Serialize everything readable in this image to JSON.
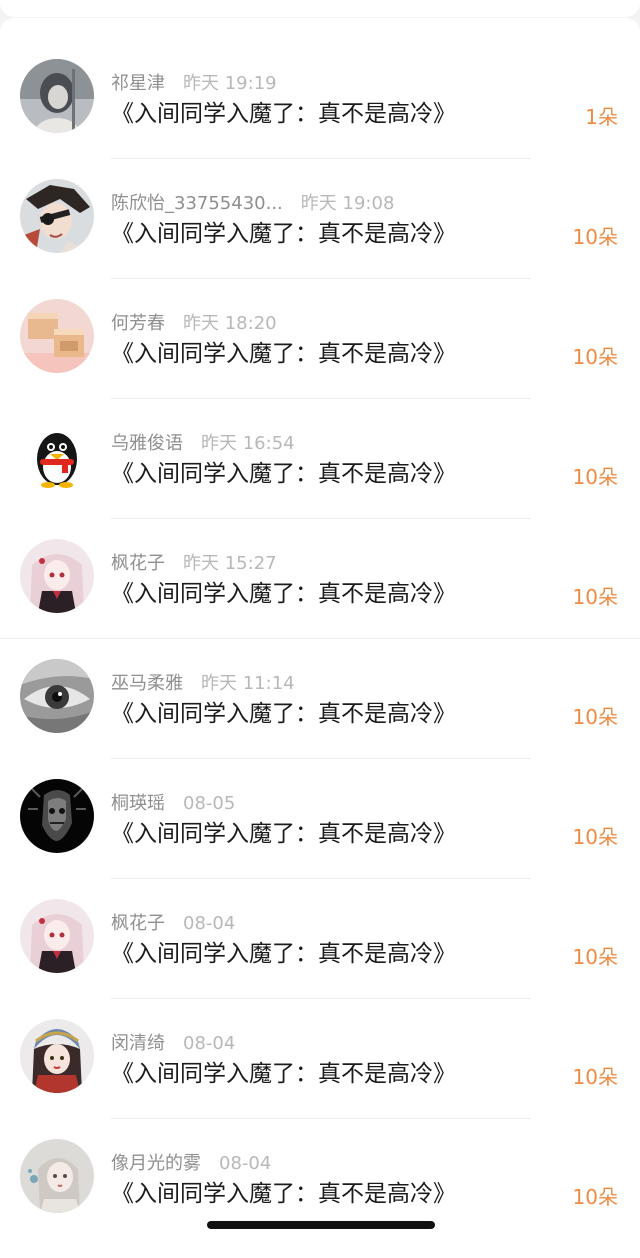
{
  "list": {
    "items": [
      {
        "name": "祁星津",
        "time": "昨天 19:19",
        "book": "《入间同学入魔了：真不是高冷》",
        "amount": "1朵",
        "avatar": "photo-girl-avatar"
      },
      {
        "name": "陈欣怡_33755430...",
        "time": "昨天 19:08",
        "book": "《入间同学入魔了：真不是高冷》",
        "amount": "10朵",
        "avatar": "anime-pirate-avatar"
      },
      {
        "name": "何芳春",
        "time": "昨天 18:20",
        "book": "《入间同学入魔了：真不是高冷》",
        "amount": "10朵",
        "avatar": "boxes-avatar"
      },
      {
        "name": "乌雅俊语",
        "time": "昨天 16:54",
        "book": "《入间同学入魔了：真不是高冷》",
        "amount": "10朵",
        "avatar": "penguin-avatar"
      },
      {
        "name": "枫花子",
        "time": "昨天 15:27",
        "book": "《入间同学入魔了：真不是高冷》",
        "amount": "10朵",
        "avatar": "anime-girl-avatar"
      },
      {
        "name": "巫马柔雅",
        "time": "昨天 11:14",
        "book": "《入间同学入魔了：真不是高冷》",
        "amount": "10朵",
        "avatar": "eye-avatar"
      },
      {
        "name": "桐瑛瑶",
        "time": "08-05",
        "book": "《入间同学入魔了：真不是高冷》",
        "amount": "10朵",
        "avatar": "dark-mask-avatar"
      },
      {
        "name": "枫花子",
        "time": "08-04",
        "book": "《入间同学入魔了：真不是高冷》",
        "amount": "10朵",
        "avatar": "anime-girl-avatar"
      },
      {
        "name": "闵清绮",
        "time": "08-04",
        "book": "《入间同学入魔了：真不是高冷》",
        "amount": "10朵",
        "avatar": "opera-girl-avatar"
      },
      {
        "name": "像月光的雾",
        "time": "08-04",
        "book": "《入间同学入魔了：真不是高冷》",
        "amount": "10朵",
        "avatar": "pale-girl-avatar"
      }
    ]
  },
  "colors": {
    "amount": "#ef8b44",
    "name": "#8f8f8f",
    "time": "#b8b8b8",
    "book": "#1b1b1b"
  }
}
